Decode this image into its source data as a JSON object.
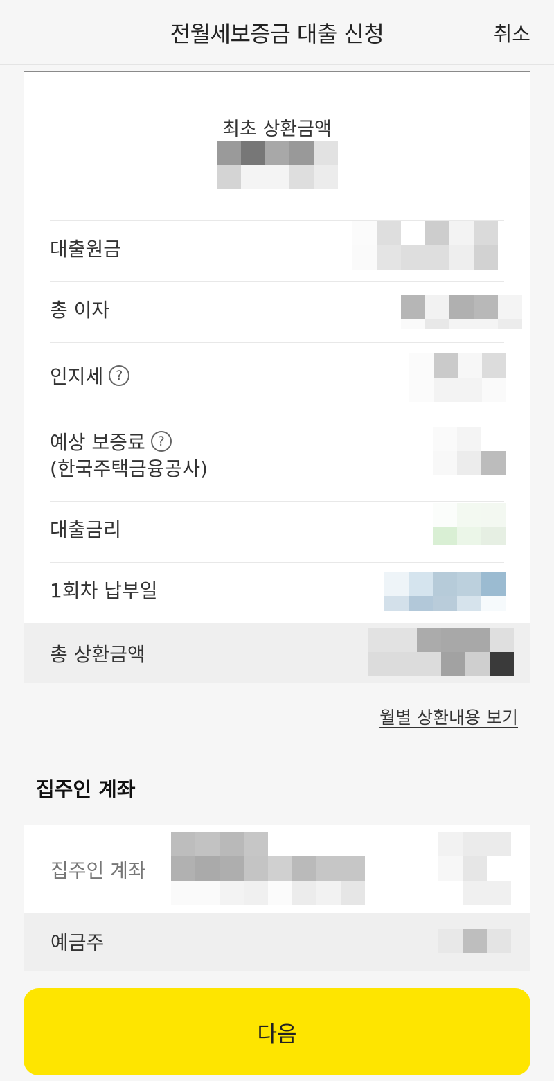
{
  "header": {
    "title": "전월세보증금 대출 신청",
    "cancel_label": "취소"
  },
  "summary": {
    "first_repayment_label": "최초 상환금액",
    "rows": [
      {
        "label": "대출원금"
      },
      {
        "label": "총 이자"
      },
      {
        "label": "인지세",
        "help": "?"
      },
      {
        "label": "예상 보증료",
        "help": "?",
        "sublabel": "(한국주택금융공사)"
      },
      {
        "label": "대출금리"
      },
      {
        "label": "1회차 납부일"
      }
    ],
    "total_label": "총 상환금액"
  },
  "monthly_link": "월별 상환내용 보기",
  "landlord": {
    "section_title": "집주인 계좌",
    "account_label": "집주인 계좌",
    "owner_label": "예금주"
  },
  "next_button": "다음",
  "colors": {
    "accent_yellow": "#fee500",
    "background": "#f6f6f6",
    "card_border": "#8a8a8a"
  }
}
